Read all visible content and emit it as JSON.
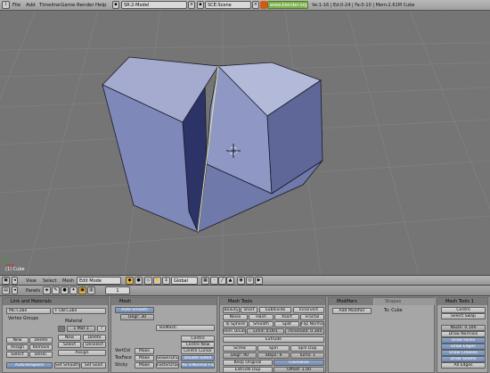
{
  "topbar": {
    "menus": [
      "File",
      "Add",
      "Timeline",
      "Game",
      "Render",
      "Help"
    ],
    "screen": "SR:2-Model",
    "scene": "SCE:Scene",
    "url": "www.blender.org 24x",
    "stats": "Ve:1-16 | Ed:0-24 | Fa:0-10 | Mem:2.61M Cube"
  },
  "viewport": {
    "object_label": "(1) Cube"
  },
  "viewheader": {
    "menus": [
      "View",
      "Select",
      "Mesh"
    ],
    "mode": "Edit Mode",
    "orientation": "Global"
  },
  "panelheader": {
    "label": "Panels",
    "frame": "1"
  },
  "link_materials": {
    "title": "Link and Materials",
    "me_field": "ME:Cube",
    "ob_field": "F OB:Cube",
    "vertex_groups": "Vertex Groups",
    "material": "Material",
    "mat_index": "1 Mat 1",
    "mat_q": "?",
    "new": "New",
    "delete": "Delete",
    "assign": "Assign",
    "remove": "Remove",
    "select": "Select",
    "deselect": "Desel.",
    "new2": "New",
    "delete2": "Delete",
    "select2": "Select",
    "deselect2": "Deselect",
    "assign2": "Assign",
    "autotexspace": "AutoTexSpace",
    "set_smooth": "Set Smooth",
    "set_solid": "Set Solid"
  },
  "mesh": {
    "title": "Mesh",
    "auto_smooth": "Auto Smooth",
    "degr": "Degr: 30",
    "texmesh": "TexMesh:",
    "centre": "Centre",
    "centre_new": "Centre New",
    "centre_cursor": "Centre Cursor",
    "vertcol": "VertCol",
    "texface": "TexFace",
    "sticky": "Sticky",
    "make": "Make",
    "slower_draw": "SlowerDraw",
    "faster_draw": "FasterDraw",
    "double_sided": "Double Sided",
    "no_vnormal_flip": "No V.Normal Flip"
  },
  "mesh_tools": {
    "title": "Mesh Tools",
    "row1": [
      "Beauty",
      "Short",
      "Subdivide",
      "Innervert"
    ],
    "row2": [
      "Noise",
      "Hash",
      "Xsort",
      "Fractal"
    ],
    "row3": [
      "To Sphere",
      "Smooth",
      "Split",
      "Flip Normal"
    ],
    "row4": [
      "Rem Doubl",
      "Limit: 0.001",
      "Threshold: 0.300"
    ],
    "extrude": "Extrude",
    "screw": "Screw",
    "spin": "Spin",
    "spin_dup": "Spin Dup",
    "degr": "Degr: 90",
    "steps": "Steps: 9",
    "turns": "Turns: 1",
    "keep_original": "Keep Original",
    "clockwise": "Clockwise",
    "extrude_dup": "Extrude Dup",
    "offset": "Offset: 1.00"
  },
  "modifiers": {
    "tab1": "Modifiers",
    "tab2": "Shapes",
    "add_modifier": "Add Modifier",
    "to": "To: Cube"
  },
  "mesh_tools1": {
    "title": "Mesh Tools 1",
    "centre": "Centre",
    "select_swap": "Select Swap",
    "nsize": "NSize: 0.100",
    "draw_normals": "Draw Normals",
    "draw_faces": "Draw Faces",
    "draw_edges": "Draw Edges",
    "draw_creases": "Draw Creases",
    "draw_seams": "Draw Seams",
    "all_edges": "All Edges"
  },
  "colors": {
    "viewport_bg": "#757575",
    "cube_top": "#9aa2c8",
    "cube_front": "#7e88b8",
    "cube_right": "#5e6798",
    "cube_inner": "#2c3366",
    "blue_button": "#7f99c2"
  }
}
